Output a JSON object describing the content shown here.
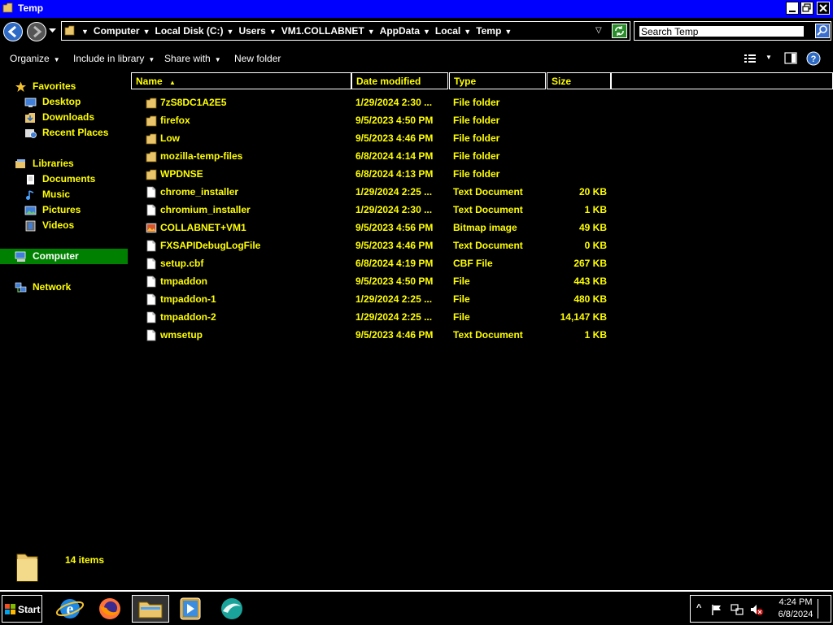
{
  "window": {
    "title": "Temp"
  },
  "address": {
    "crumbs": [
      "Computer",
      "Local Disk (C:)",
      "Users",
      "VM1.COLLABNET",
      "AppData",
      "Local",
      "Temp"
    ]
  },
  "search": {
    "value": "Search Temp"
  },
  "toolbar": {
    "organize": "Organize",
    "include_in_library": "Include in library",
    "share_with": "Share with",
    "new_folder": "New folder"
  },
  "nav": {
    "favorites": "Favorites",
    "desktop": "Desktop",
    "downloads": "Downloads",
    "recent_places": "Recent Places",
    "libraries": "Libraries",
    "documents": "Documents",
    "music": "Music",
    "pictures": "Pictures",
    "videos": "Videos",
    "computer": "Computer",
    "network": "Network"
  },
  "columns": {
    "name": "Name",
    "date_modified": "Date modified",
    "type": "Type",
    "size": "Size"
  },
  "files": [
    {
      "name": "7zS8DC1A2E5",
      "date": "1/29/2024 2:30 ...",
      "type": "File folder",
      "size": "",
      "icon": "folder-icon"
    },
    {
      "name": "firefox",
      "date": "9/5/2023 4:50 PM",
      "type": "File folder",
      "size": "",
      "icon": "folder-icon"
    },
    {
      "name": "Low",
      "date": "9/5/2023 4:46 PM",
      "type": "File folder",
      "size": "",
      "icon": "folder-icon"
    },
    {
      "name": "mozilla-temp-files",
      "date": "6/8/2024 4:14 PM",
      "type": "File folder",
      "size": "",
      "icon": "folder-icon"
    },
    {
      "name": "WPDNSE",
      "date": "6/8/2024 4:13 PM",
      "type": "File folder",
      "size": "",
      "icon": "folder-icon"
    },
    {
      "name": "chrome_installer",
      "date": "1/29/2024 2:25 ...",
      "type": "Text Document",
      "size": "20 KB",
      "icon": "document-icon"
    },
    {
      "name": "chromium_installer",
      "date": "1/29/2024 2:30 ...",
      "type": "Text Document",
      "size": "1 KB",
      "icon": "document-icon"
    },
    {
      "name": "COLLABNET+VM1",
      "date": "9/5/2023 4:56 PM",
      "type": "Bitmap image",
      "size": "49 KB",
      "icon": "bitmap-icon"
    },
    {
      "name": "FXSAPIDebugLogFile",
      "date": "9/5/2023 4:46 PM",
      "type": "Text Document",
      "size": "0 KB",
      "icon": "document-icon"
    },
    {
      "name": "setup.cbf",
      "date": "6/8/2024 4:19 PM",
      "type": "CBF File",
      "size": "267 KB",
      "icon": "document-icon"
    },
    {
      "name": "tmpaddon",
      "date": "9/5/2023 4:50 PM",
      "type": "File",
      "size": "443 KB",
      "icon": "document-icon"
    },
    {
      "name": "tmpaddon-1",
      "date": "1/29/2024 2:25 ...",
      "type": "File",
      "size": "480 KB",
      "icon": "document-icon"
    },
    {
      "name": "tmpaddon-2",
      "date": "1/29/2024 2:25 ...",
      "type": "File",
      "size": "14,147 KB",
      "icon": "document-icon"
    },
    {
      "name": "wmsetup",
      "date": "9/5/2023 4:46 PM",
      "type": "Text Document",
      "size": "1 KB",
      "icon": "document-icon"
    }
  ],
  "status": {
    "item_count": "14 items"
  },
  "taskbar": {
    "start_label": "Start",
    "apps": [
      "internet-explorer-icon",
      "firefox-icon",
      "file-explorer-icon",
      "media-player-icon",
      "remote-app-icon"
    ],
    "time": "4:24 PM",
    "date": "6/8/2024"
  },
  "colors": {
    "title_bar": "#0000ff",
    "text_highlight": "#ffff00",
    "selection": "#008000",
    "background": "#000000"
  }
}
